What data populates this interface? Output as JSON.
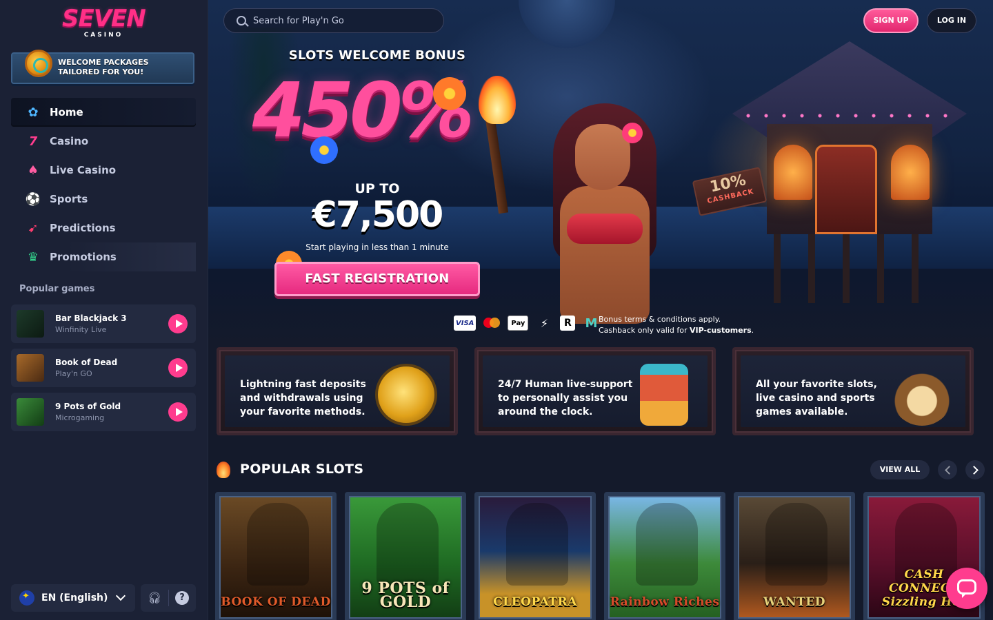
{
  "brand": {
    "name": "SEVEN",
    "sub": "CASINO"
  },
  "welcome": {
    "text": "WELCOME PACKAGES\nTAILORED FOR YOU!"
  },
  "nav": [
    {
      "label": "Home",
      "icon": "home-icon",
      "active": true
    },
    {
      "label": "Casino",
      "icon": "seven-icon"
    },
    {
      "label": "Live Casino",
      "icon": "poker-chip-icon"
    },
    {
      "label": "Sports",
      "icon": "soccer-ball-icon"
    },
    {
      "label": "Predictions",
      "icon": "predictions-icon"
    },
    {
      "label": "Promotions",
      "icon": "tiki-icon"
    }
  ],
  "popular_games": {
    "label": "Popular games",
    "items": [
      {
        "name": "Bar Blackjack 3",
        "provider": "Winfinity Live"
      },
      {
        "name": "Book of Dead",
        "provider": "Play'n GO"
      },
      {
        "name": "9 Pots of Gold",
        "provider": "Microgaming"
      }
    ]
  },
  "footer": {
    "language": "EN (English)"
  },
  "search": {
    "placeholder": "Search for Play'n Go"
  },
  "auth": {
    "signup": "SIGN UP",
    "login": "LOG IN"
  },
  "hero": {
    "title": "SLOTS WELCOME BONUS",
    "percent": "450%",
    "up_to": "UP TO",
    "amount": "€7,500",
    "sub": "Start playing in less than 1 minute",
    "cta": "FAST REGISTRATION",
    "cashback_value": "10%",
    "cashback_label": "CASHBACK",
    "terms_line1": "Bonus terms & conditions apply.",
    "terms_line2_prefix": "Cashback only valid for ",
    "terms_line2_bold": "VIP-customers",
    "terms_line2_suffix": "."
  },
  "payments": [
    "VISA",
    "Mastercard",
    "Apple Pay",
    "⚡",
    "R",
    "M"
  ],
  "features": [
    {
      "text": "Lightning fast deposits and withdrawals using your favorite methods."
    },
    {
      "text": "24/7 Human live-support to personally assist you around the clock."
    },
    {
      "text": "All your favorite slots, live casino and sports games available."
    }
  ],
  "popular_slots": {
    "title": "POPULAR SLOTS",
    "view_all": "VIEW ALL",
    "items": [
      {
        "name": "BOOK OF DEAD"
      },
      {
        "name": "9 POTS of GOLD"
      },
      {
        "name": "CLEOPATRA"
      },
      {
        "name": "Rainbow Riches"
      },
      {
        "name": "WANTED"
      },
      {
        "name": "CASH CONNECT Sizzling Hot"
      }
    ]
  },
  "colors": {
    "accent": "#ff3c8e",
    "background": "#141a2b",
    "sidebar": "#1b2135"
  }
}
